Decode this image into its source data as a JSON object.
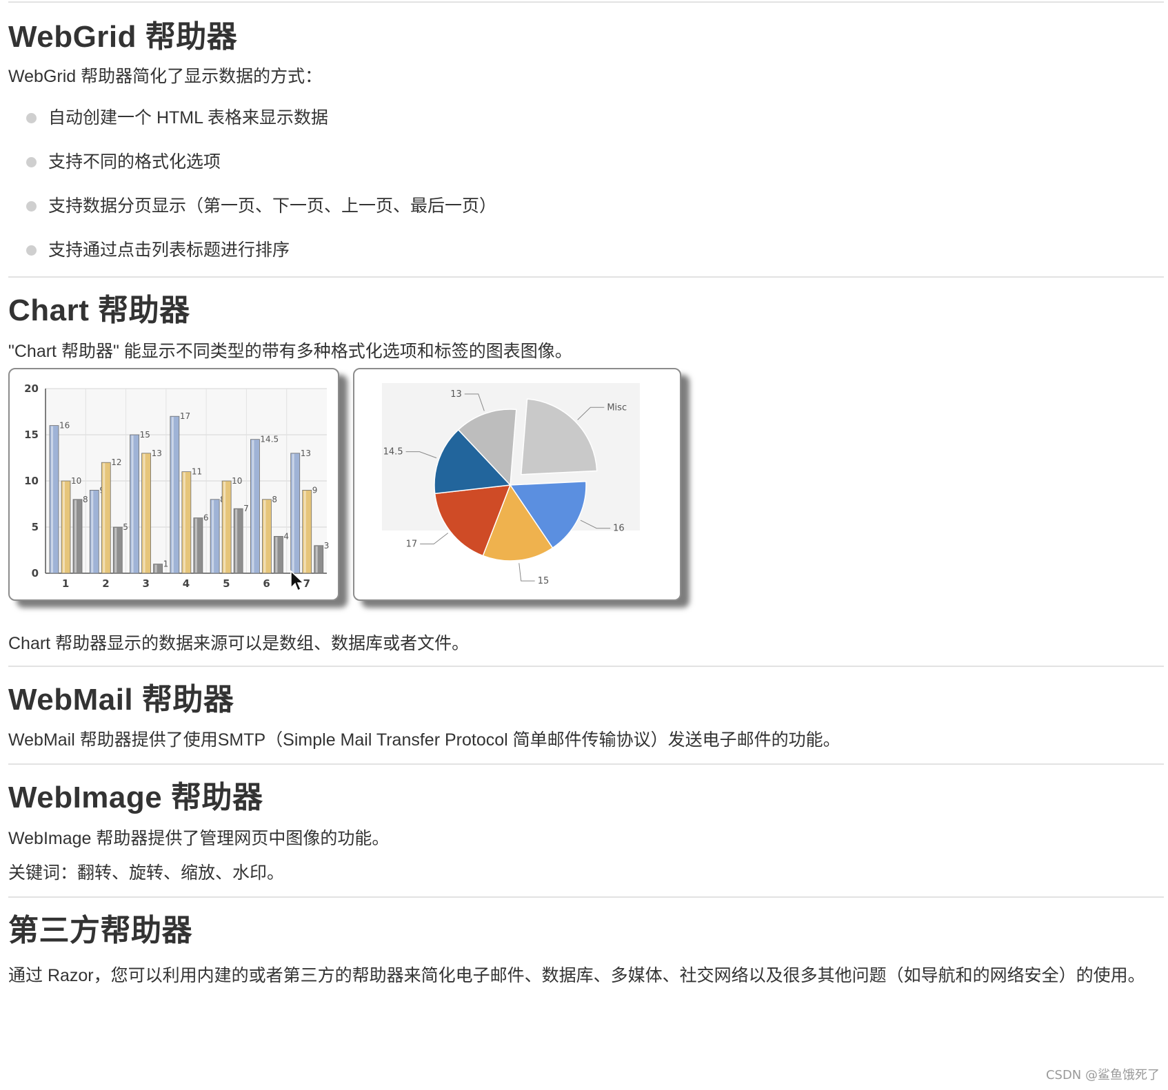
{
  "sections": {
    "webgrid": {
      "title": "WebGrid 帮助器",
      "intro": "WebGrid 帮助器简化了显示数据的方式：",
      "features": [
        "自动创建一个 HTML 表格来显示数据",
        "支持不同的格式化选项",
        "支持数据分页显示（第一页、下一页、上一页、最后一页）",
        "支持通过点击列表标题进行排序"
      ]
    },
    "chart": {
      "title": "Chart 帮助器",
      "intro": "\"Chart 帮助器\" 能显示不同类型的带有多种格式化选项和标签的图表图像。",
      "outro": "Chart 帮助器显示的数据来源可以是数组、数据库或者文件。"
    },
    "webmail": {
      "title": "WebMail 帮助器",
      "text": "WebMail 帮助器提供了使用SMTP（Simple Mail Transfer Protocol 简单邮件传输协议）发送电子邮件的功能。"
    },
    "webimage": {
      "title": "WebImage 帮助器",
      "text": "WebImage 帮助器提供了管理网页中图像的功能。",
      "keywords": "关键词：翻转、旋转、缩放、水印。"
    },
    "thirdparty": {
      "title": "第三方帮助器",
      "text": "通过 Razor，您可以利用内建的或者第三方的帮助器来简化电子邮件、数据库、多媒体、社交网络以及很多其他问题（如导航和的网络安全）的使用。"
    }
  },
  "watermark": "CSDN @鲨鱼饿死了",
  "colors": {
    "blue_bar": "#9fb3d6",
    "gold_bar": "#e6c57a",
    "gray_bar": "#8e8e8e"
  },
  "chart_data": [
    {
      "type": "bar",
      "categories": [
        "1",
        "2",
        "3",
        "4",
        "5",
        "6",
        "7"
      ],
      "series": [
        {
          "values": [
            16,
            9,
            15,
            17,
            8,
            14.5,
            13
          ]
        },
        {
          "values": [
            10,
            12,
            13,
            11,
            10,
            8,
            9
          ]
        },
        {
          "values": [
            8,
            5,
            1,
            6,
            7,
            4,
            3
          ]
        }
      ],
      "ylim": [
        0,
        20
      ],
      "yticks": [
        0,
        5,
        10,
        15,
        20
      ],
      "grid": true,
      "value_labels": [
        [
          "16",
          "9",
          "15",
          "17",
          "8",
          "14.5",
          "13"
        ],
        [
          "10",
          "12",
          "13",
          "11",
          "10",
          "8",
          "9"
        ],
        [
          "8",
          "5",
          "1",
          "6",
          "7",
          "4",
          "3"
        ]
      ]
    },
    {
      "type": "pie",
      "slices": [
        {
          "label": "Misc",
          "value": 22.5,
          "color": "#c9c9c9",
          "exploded": true
        },
        {
          "label": "16",
          "value": 16,
          "color": "#5b8fe0"
        },
        {
          "label": "15",
          "value": 15,
          "color": "#efb24e"
        },
        {
          "label": "17",
          "value": 17,
          "color": "#cf4b26"
        },
        {
          "label": "14.5",
          "value": 14.5,
          "color": "#22659c"
        },
        {
          "label": "13",
          "value": 13,
          "color": "#bdbdbd"
        }
      ]
    }
  ]
}
